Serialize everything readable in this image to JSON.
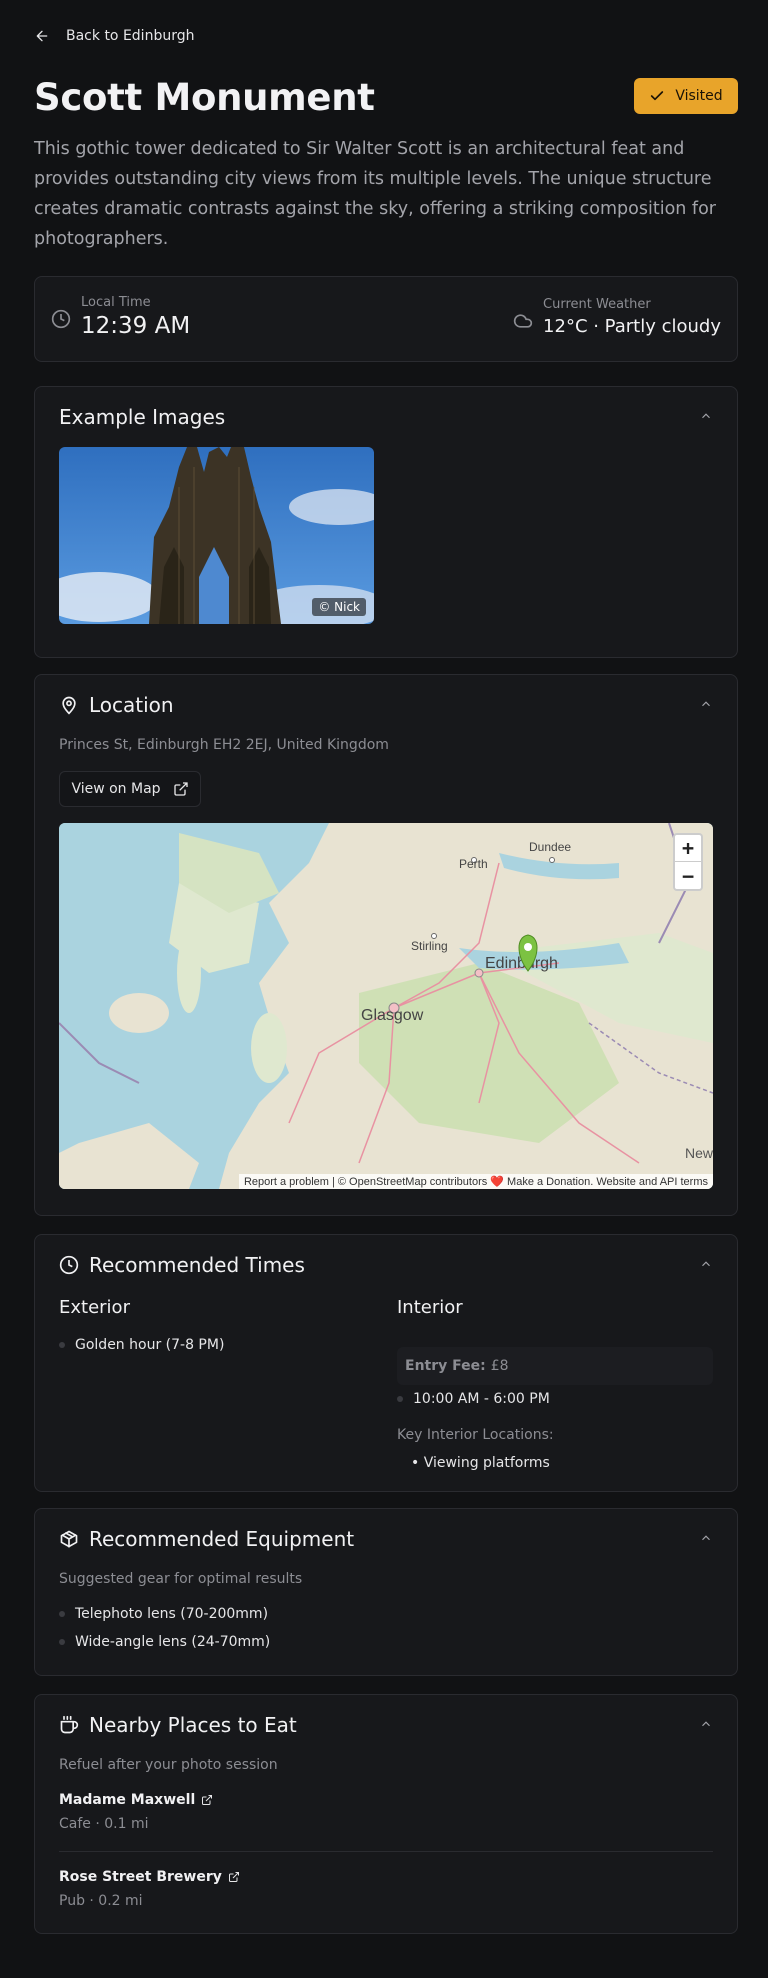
{
  "nav": {
    "back_label": "Back to Edinburgh"
  },
  "header": {
    "title": "Scott Monument",
    "visited_label": "Visited",
    "description": "This gothic tower dedicated to Sir Walter Scott is an architectural feat and provides outstanding city views from its multiple levels. The unique structure creates dramatic contrasts against the sky, offering a striking composition for photographers."
  },
  "status": {
    "time_label": "Local Time",
    "time_value": "12:39 AM",
    "weather_label": "Current Weather",
    "weather_value": "12°C · Partly cloudy"
  },
  "images": {
    "heading": "Example Images",
    "credit": "© Nick"
  },
  "location": {
    "heading": "Location",
    "address": "Princes St, Edinburgh EH2 2EJ, United Kingdom",
    "map_button": "View on Map",
    "map_labels": {
      "perth": "Perth",
      "dundee": "Dundee",
      "stirling": "Stirling",
      "edinburgh": "Edinburgh",
      "glasgow": "Glasgow",
      "newcastle": "New"
    },
    "zoom_in": "+",
    "zoom_out": "−",
    "attribution": "Report a problem | © OpenStreetMap contributors ❤️ Make a Donation. Website and API terms"
  },
  "times": {
    "heading": "Recommended Times",
    "exterior_heading": "Exterior",
    "exterior_items": [
      "Golden hour (7-8 PM)"
    ],
    "interior_heading": "Interior",
    "entry_fee_label": "Entry Fee:",
    "entry_fee_value": "£8",
    "hours": "10:00 AM - 6:00 PM",
    "key_locations_label": "Key Interior Locations:",
    "key_locations": [
      "• Viewing platforms"
    ]
  },
  "equipment": {
    "heading": "Recommended Equipment",
    "subtitle": "Suggested gear for optimal results",
    "items": [
      "Telephoto lens (70-200mm)",
      "Wide-angle lens (24-70mm)"
    ]
  },
  "eat": {
    "heading": "Nearby Places to Eat",
    "subtitle": "Refuel after your photo session",
    "places": [
      {
        "name": "Madame Maxwell",
        "meta": "Cafe · 0.1 mi"
      },
      {
        "name": "Rose Street Brewery",
        "meta": "Pub · 0.2 mi"
      }
    ]
  },
  "colors": {
    "accent": "#e8a42a",
    "background": "#111214",
    "card": "#17181b",
    "border": "#2a2b30",
    "marker": "#7cc242"
  },
  "icons": [
    "arrow-left-icon",
    "check-icon",
    "clock-icon",
    "cloud-icon",
    "chevron-up-icon",
    "map-pin-icon",
    "external-link-icon",
    "package-icon",
    "coffee-icon"
  ]
}
